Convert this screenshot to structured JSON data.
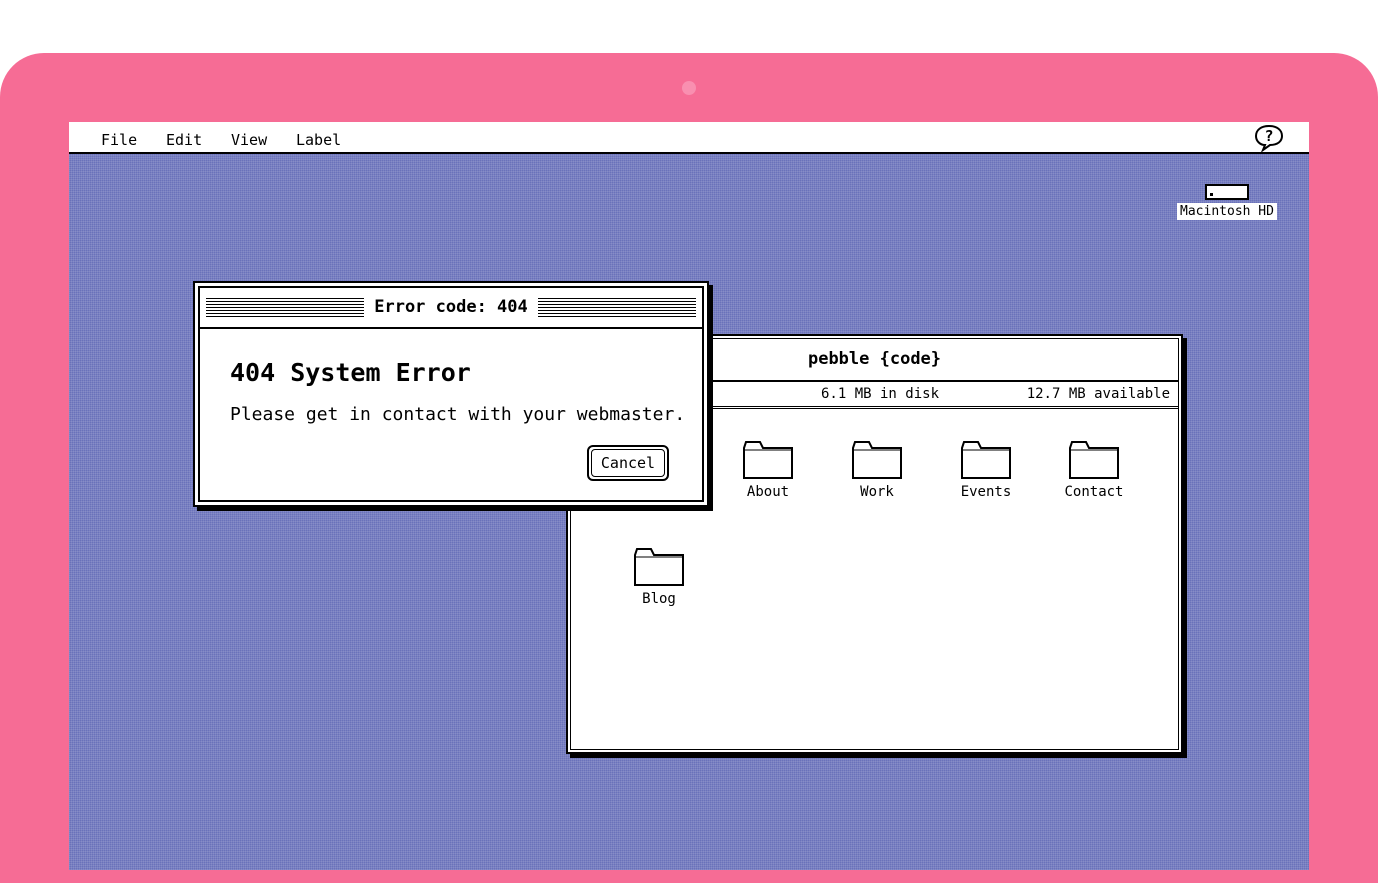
{
  "menubar": {
    "items": [
      {
        "label": "File"
      },
      {
        "label": "Edit"
      },
      {
        "label": "View"
      },
      {
        "label": "Label"
      }
    ],
    "help_icon": "help-question-icon"
  },
  "desktop": {
    "disk_label": "Macintosh HD",
    "disk_icon": "hard-disk-icon"
  },
  "finder_window": {
    "title": "pebble {code}",
    "disk_used": "6.1 MB in disk",
    "available": "12.7 MB available",
    "folders": [
      {
        "label": "About",
        "icon": "folder-icon"
      },
      {
        "label": "Work",
        "icon": "folder-icon"
      },
      {
        "label": "Events",
        "icon": "folder-icon"
      },
      {
        "label": "Contact",
        "icon": "folder-icon"
      },
      {
        "label": "Blog",
        "icon": "folder-icon"
      }
    ]
  },
  "error_dialog": {
    "title": "Error code: 404",
    "heading": "404 System Error",
    "message": "Please get in contact with your webmaster.",
    "cancel_label": "Cancel"
  },
  "colors": {
    "bezel": "#f66c95",
    "desktop": "#6a72ba"
  }
}
